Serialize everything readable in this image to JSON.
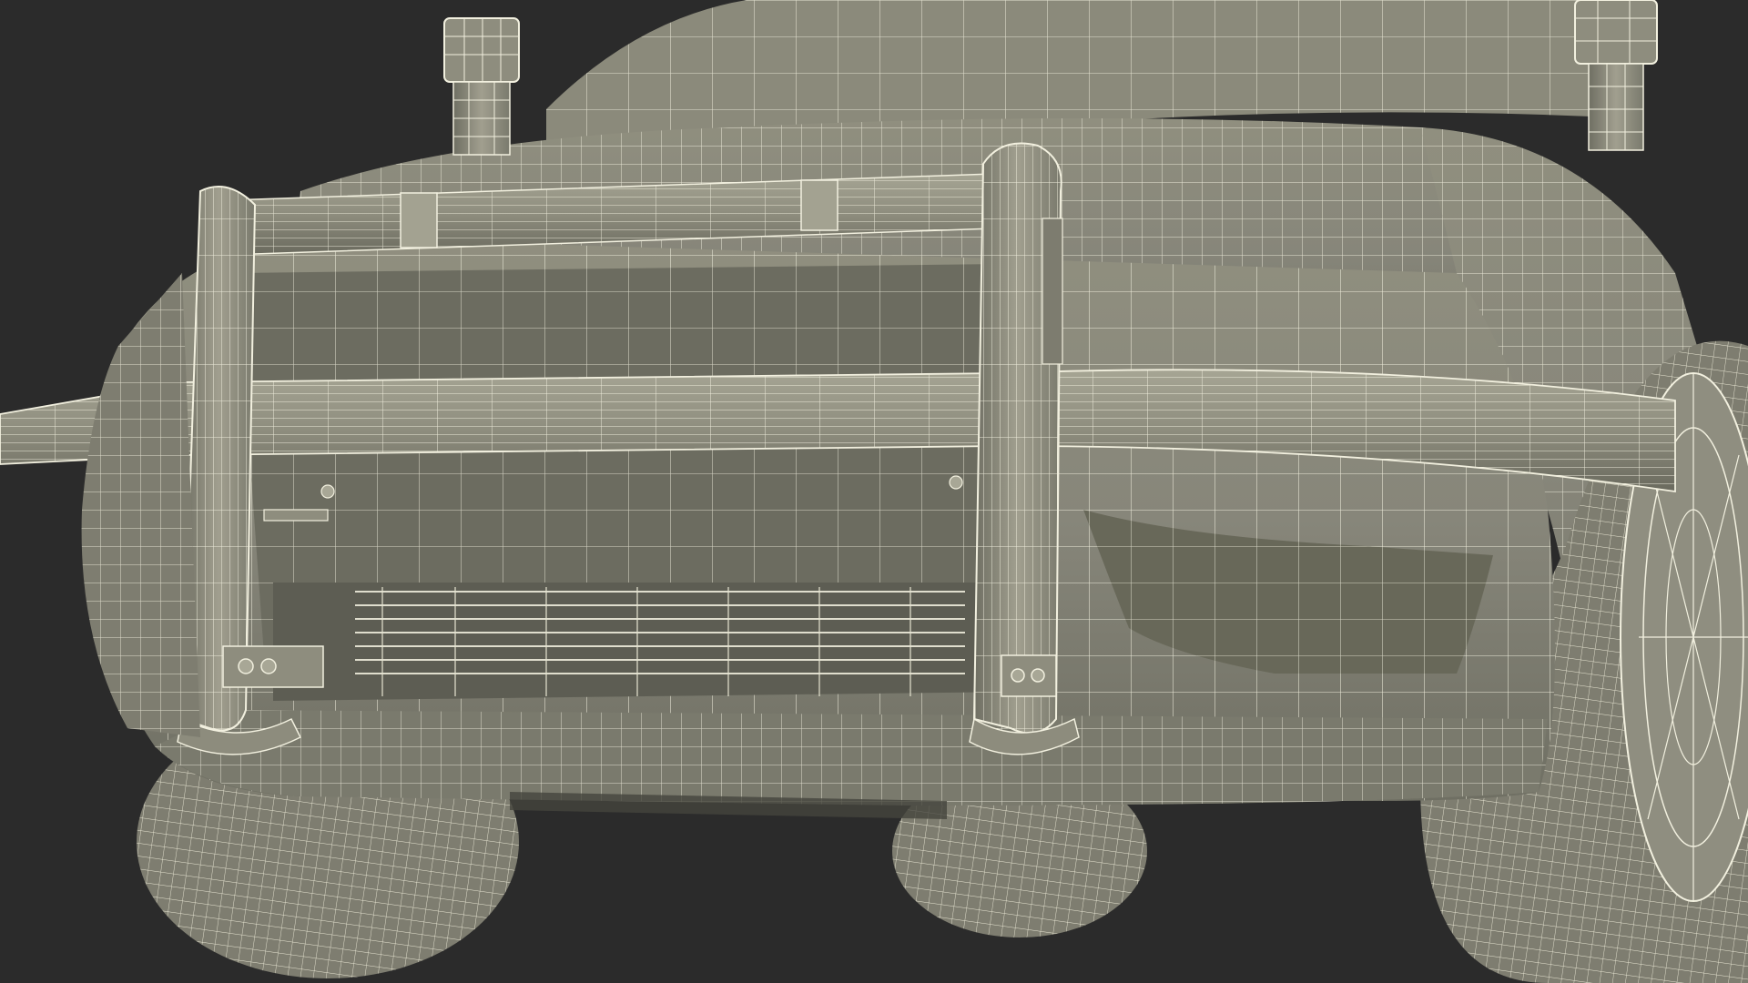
{
  "scene": {
    "background_color": "#2b2b2b",
    "surface_color": "#8a8a7a",
    "surface_dark_color": "#6f6f61",
    "surface_light_color": "#a09f8e",
    "wire_color": "#f2f0df",
    "wire_dim_color": "#d9d7c4",
    "shadow_color": "#55554a"
  }
}
